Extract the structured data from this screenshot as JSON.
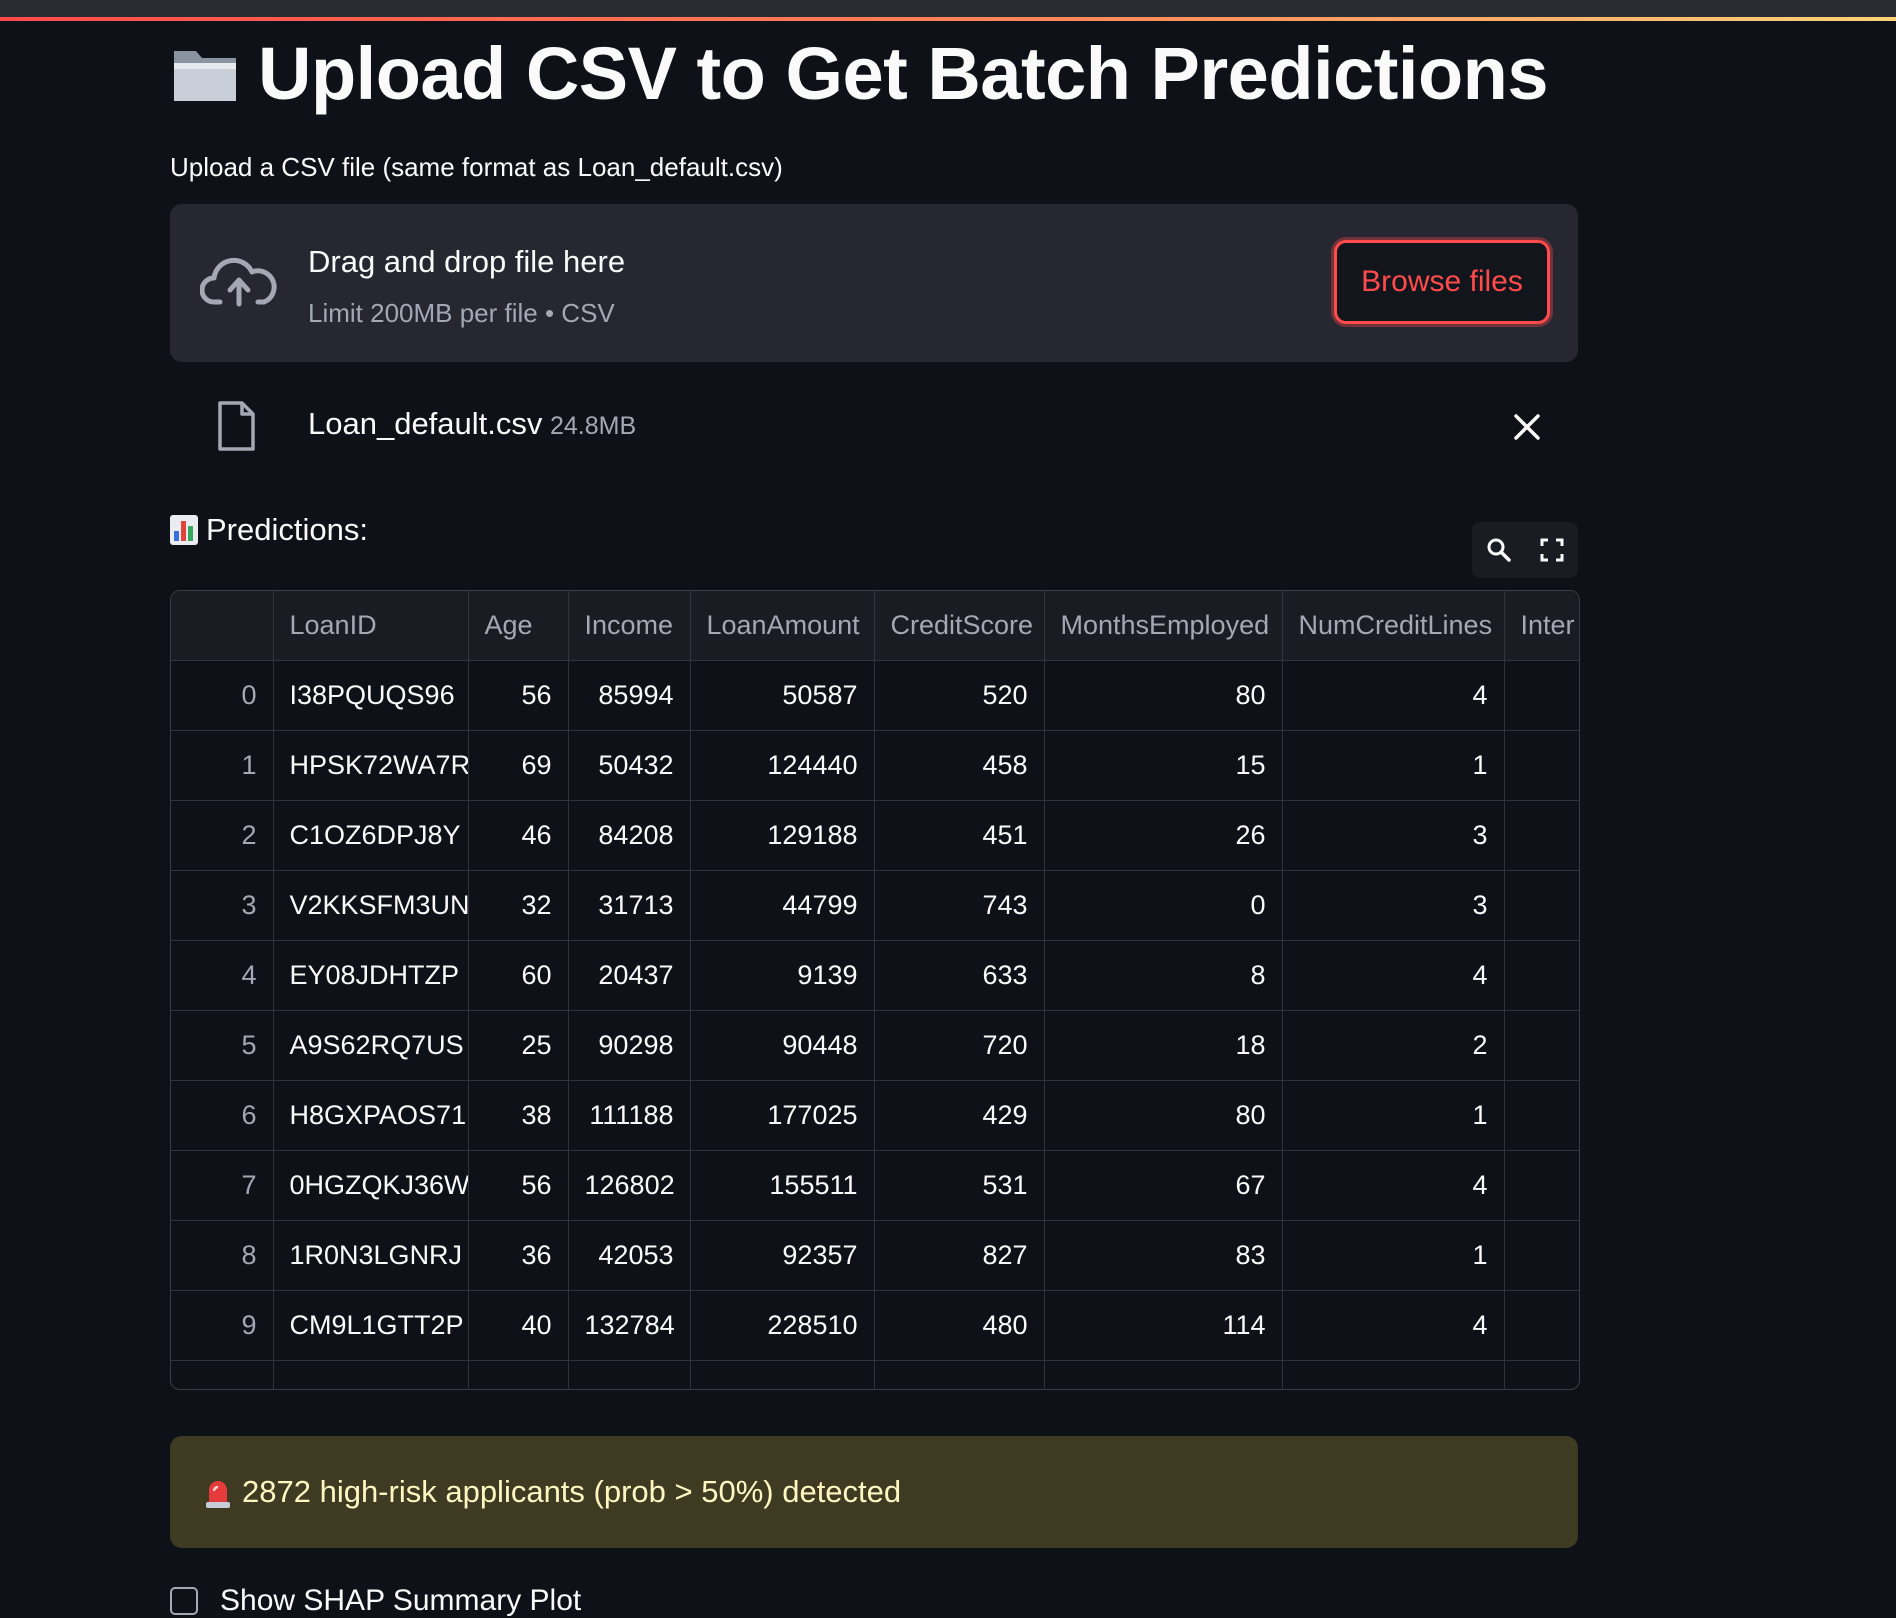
{
  "page": {
    "title": "Upload CSV to Get Batch Predictions",
    "title_icon": "folder-icon"
  },
  "uploader": {
    "label": "Upload a CSV file (same format as Loan_default.csv)",
    "drop_title": "Drag and drop file here",
    "drop_subtitle": "Limit 200MB per file • CSV",
    "browse_label": "Browse files",
    "accent_color": "#ff4b4b"
  },
  "uploaded_file": {
    "name": "Loan_default.csv",
    "size": "24.8MB"
  },
  "predictions": {
    "label": "Predictions:",
    "icon": "bar-chart-icon",
    "columns": [
      "",
      "LoanID",
      "Age",
      "Income",
      "LoanAmount",
      "CreditScore",
      "MonthsEmployed",
      "NumCreditLines",
      "Inter"
    ],
    "rows": [
      [
        "0",
        "I38PQUQS96",
        "56",
        "85994",
        "50587",
        "520",
        "80",
        "4"
      ],
      [
        "1",
        "HPSK72WA7R",
        "69",
        "50432",
        "124440",
        "458",
        "15",
        "1"
      ],
      [
        "2",
        "C1OZ6DPJ8Y",
        "46",
        "84208",
        "129188",
        "451",
        "26",
        "3"
      ],
      [
        "3",
        "V2KKSFM3UN",
        "32",
        "31713",
        "44799",
        "743",
        "0",
        "3"
      ],
      [
        "4",
        "EY08JDHTZP",
        "60",
        "20437",
        "9139",
        "633",
        "8",
        "4"
      ],
      [
        "5",
        "A9S62RQ7US",
        "25",
        "90298",
        "90448",
        "720",
        "18",
        "2"
      ],
      [
        "6",
        "H8GXPAOS71",
        "38",
        "111188",
        "177025",
        "429",
        "80",
        "1"
      ],
      [
        "7",
        "0HGZQKJ36W",
        "56",
        "126802",
        "155511",
        "531",
        "67",
        "4"
      ],
      [
        "8",
        "1R0N3LGNRJ",
        "36",
        "42053",
        "92357",
        "827",
        "83",
        "1"
      ],
      [
        "9",
        "CM9L1GTT2P",
        "40",
        "132784",
        "228510",
        "480",
        "114",
        "4"
      ]
    ]
  },
  "alert": {
    "icon": "siren-icon",
    "text": "2872 high-risk applicants (prob > 50%) detected",
    "background": "#3e3b22"
  },
  "shap_checkbox": {
    "label": "Show SHAP Summary Plot",
    "checked": false
  }
}
